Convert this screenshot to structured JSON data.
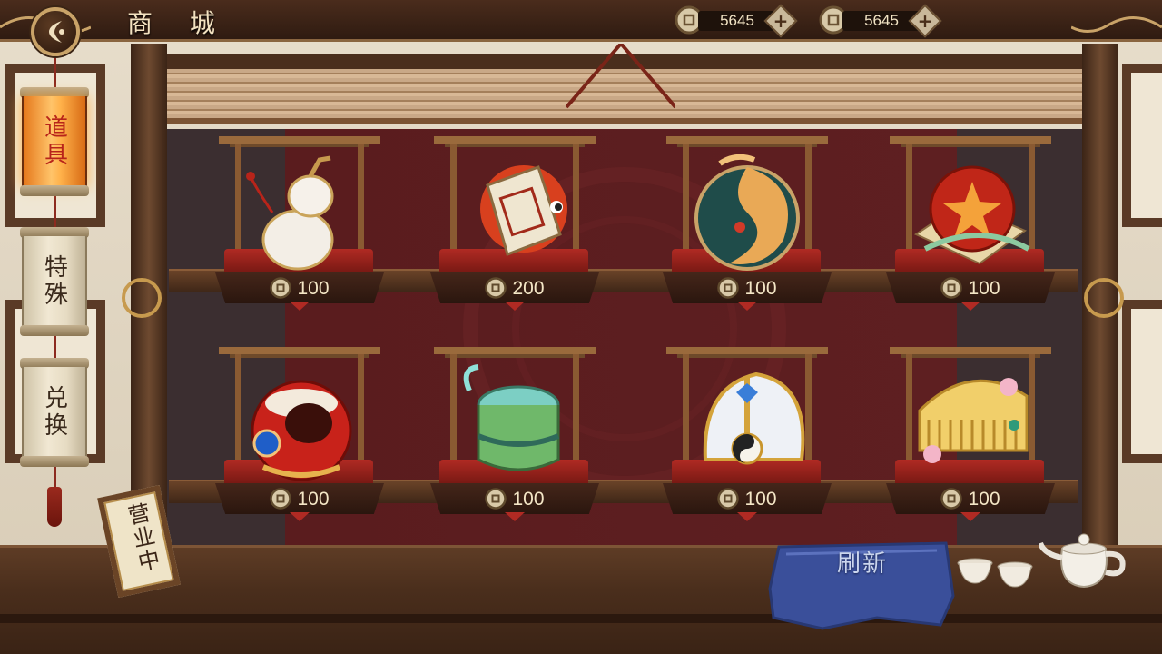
{
  "header": {
    "title": "商 城",
    "currencies": [
      {
        "icon": "copper-coin-icon",
        "amount": "5645"
      },
      {
        "icon": "copper-coin-icon",
        "amount": "5645"
      }
    ]
  },
  "tabs": [
    {
      "label": "道具",
      "active": true
    },
    {
      "label": "特殊",
      "active": false
    },
    {
      "label": "兑换",
      "active": false
    }
  ],
  "shop_items": [
    {
      "icon": "white-gourd-icon",
      "price": "100"
    },
    {
      "icon": "koi-fish-scroll-icon",
      "price": "200"
    },
    {
      "icon": "jade-phoenix-orb-icon",
      "price": "100"
    },
    {
      "icon": "red-flower-ball-icon",
      "price": "100"
    },
    {
      "icon": "lion-mask-icon",
      "price": "100"
    },
    {
      "icon": "bamboo-water-cup-icon",
      "price": "100"
    },
    {
      "icon": "taiji-helmet-icon",
      "price": "100"
    },
    {
      "icon": "golden-comb-icon",
      "price": "100"
    }
  ],
  "counter": {
    "open_sign": "营业中",
    "refresh_label": "刷新"
  },
  "colors": {
    "accent_gold": "#c9a368",
    "active_tab": "#ffb14a",
    "backdrop_red": "#5e1f21",
    "cloth_blue": "#3a4f9a"
  }
}
